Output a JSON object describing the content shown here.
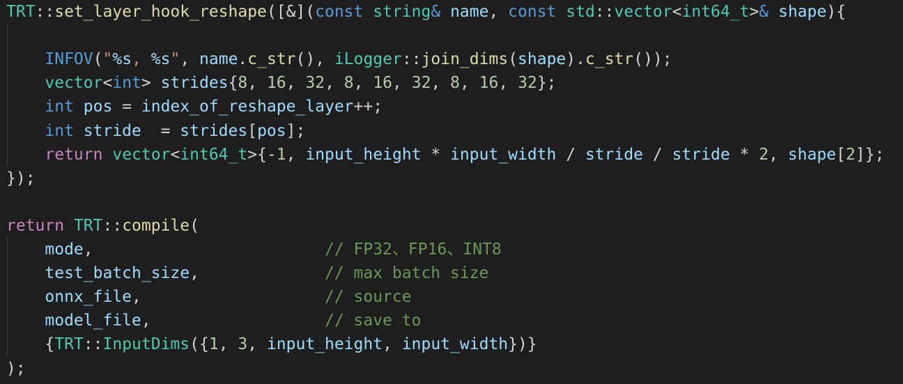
{
  "editor": {
    "theme_colors": {
      "background": "#1e1e1e",
      "plain": "#d4d4d4",
      "type": "#4ec9b0",
      "keyword": "#569cd6",
      "control": "#c586c0",
      "function": "#dcdcaa",
      "variable": "#9cdcfe",
      "string": "#ce9178",
      "number": "#b5cea8",
      "comment": "#6a9955"
    },
    "lines": [
      [
        {
          "t": "TRT",
          "c": "type"
        },
        {
          "t": "::",
          "c": "plain"
        },
        {
          "t": "set_layer_hook_reshape",
          "c": "fn"
        },
        {
          "t": "([&](",
          "c": "plain"
        },
        {
          "t": "const",
          "c": "kw"
        },
        {
          "t": " ",
          "c": "plain"
        },
        {
          "t": "string",
          "c": "type"
        },
        {
          "t": "&",
          "c": "kw"
        },
        {
          "t": " ",
          "c": "plain"
        },
        {
          "t": "name",
          "c": "var"
        },
        {
          "t": ", ",
          "c": "plain"
        },
        {
          "t": "const",
          "c": "kw"
        },
        {
          "t": " ",
          "c": "plain"
        },
        {
          "t": "std",
          "c": "type"
        },
        {
          "t": "::",
          "c": "plain"
        },
        {
          "t": "vector",
          "c": "type"
        },
        {
          "t": "<",
          "c": "plain"
        },
        {
          "t": "int64_t",
          "c": "type"
        },
        {
          "t": ">",
          "c": "plain"
        },
        {
          "t": "&",
          "c": "kw"
        },
        {
          "t": " ",
          "c": "plain"
        },
        {
          "t": "shape",
          "c": "var"
        },
        {
          "t": "){",
          "c": "plain"
        }
      ],
      [],
      [
        {
          "t": "    ",
          "c": "plain"
        },
        {
          "t": "INFOV",
          "c": "macro"
        },
        {
          "t": "(",
          "c": "plain"
        },
        {
          "t": "\"",
          "c": "str"
        },
        {
          "t": "%s",
          "c": "esc"
        },
        {
          "t": ", ",
          "c": "str"
        },
        {
          "t": "%s",
          "c": "esc"
        },
        {
          "t": "\"",
          "c": "str"
        },
        {
          "t": ", ",
          "c": "plain"
        },
        {
          "t": "name",
          "c": "var"
        },
        {
          "t": ".",
          "c": "plain"
        },
        {
          "t": "c_str",
          "c": "fn"
        },
        {
          "t": "(), ",
          "c": "plain"
        },
        {
          "t": "iLogger",
          "c": "type"
        },
        {
          "t": "::",
          "c": "plain"
        },
        {
          "t": "join_dims",
          "c": "fn"
        },
        {
          "t": "(",
          "c": "plain"
        },
        {
          "t": "shape",
          "c": "var"
        },
        {
          "t": ").",
          "c": "plain"
        },
        {
          "t": "c_str",
          "c": "fn"
        },
        {
          "t": "());",
          "c": "plain"
        }
      ],
      [
        {
          "t": "    ",
          "c": "plain"
        },
        {
          "t": "vector",
          "c": "type"
        },
        {
          "t": "<",
          "c": "plain"
        },
        {
          "t": "int",
          "c": "kw"
        },
        {
          "t": "> ",
          "c": "plain"
        },
        {
          "t": "strides",
          "c": "var"
        },
        {
          "t": "{",
          "c": "plain"
        },
        {
          "t": "8",
          "c": "num"
        },
        {
          "t": ", ",
          "c": "plain"
        },
        {
          "t": "16",
          "c": "num"
        },
        {
          "t": ", ",
          "c": "plain"
        },
        {
          "t": "32",
          "c": "num"
        },
        {
          "t": ", ",
          "c": "plain"
        },
        {
          "t": "8",
          "c": "num"
        },
        {
          "t": ", ",
          "c": "plain"
        },
        {
          "t": "16",
          "c": "num"
        },
        {
          "t": ", ",
          "c": "plain"
        },
        {
          "t": "32",
          "c": "num"
        },
        {
          "t": ", ",
          "c": "plain"
        },
        {
          "t": "8",
          "c": "num"
        },
        {
          "t": ", ",
          "c": "plain"
        },
        {
          "t": "16",
          "c": "num"
        },
        {
          "t": ", ",
          "c": "plain"
        },
        {
          "t": "32",
          "c": "num"
        },
        {
          "t": "};",
          "c": "plain"
        }
      ],
      [
        {
          "t": "    ",
          "c": "plain"
        },
        {
          "t": "int",
          "c": "kw"
        },
        {
          "t": " ",
          "c": "plain"
        },
        {
          "t": "pos",
          "c": "var"
        },
        {
          "t": " = ",
          "c": "plain"
        },
        {
          "t": "index_of_reshape_layer",
          "c": "var"
        },
        {
          "t": "++;",
          "c": "plain"
        }
      ],
      [
        {
          "t": "    ",
          "c": "plain"
        },
        {
          "t": "int",
          "c": "kw"
        },
        {
          "t": " ",
          "c": "plain"
        },
        {
          "t": "stride",
          "c": "var"
        },
        {
          "t": "  = ",
          "c": "plain"
        },
        {
          "t": "strides",
          "c": "var"
        },
        {
          "t": "[",
          "c": "plain"
        },
        {
          "t": "pos",
          "c": "var"
        },
        {
          "t": "];",
          "c": "plain"
        }
      ],
      [
        {
          "t": "    ",
          "c": "plain"
        },
        {
          "t": "return",
          "c": "ctrl"
        },
        {
          "t": " ",
          "c": "plain"
        },
        {
          "t": "vector",
          "c": "type"
        },
        {
          "t": "<",
          "c": "plain"
        },
        {
          "t": "int64_t",
          "c": "type"
        },
        {
          "t": ">{-",
          "c": "plain"
        },
        {
          "t": "1",
          "c": "num"
        },
        {
          "t": ", ",
          "c": "plain"
        },
        {
          "t": "input_height",
          "c": "var"
        },
        {
          "t": " * ",
          "c": "plain"
        },
        {
          "t": "input_width",
          "c": "var"
        },
        {
          "t": " / ",
          "c": "plain"
        },
        {
          "t": "stride",
          "c": "var"
        },
        {
          "t": " / ",
          "c": "plain"
        },
        {
          "t": "stride",
          "c": "var"
        },
        {
          "t": " * ",
          "c": "plain"
        },
        {
          "t": "2",
          "c": "num"
        },
        {
          "t": ", ",
          "c": "plain"
        },
        {
          "t": "shape",
          "c": "var"
        },
        {
          "t": "[",
          "c": "plain"
        },
        {
          "t": "2",
          "c": "num"
        },
        {
          "t": "]};",
          "c": "plain"
        }
      ],
      [
        {
          "t": "});",
          "c": "plain"
        }
      ],
      [],
      [
        {
          "t": "return",
          "c": "ctrl"
        },
        {
          "t": " ",
          "c": "plain"
        },
        {
          "t": "TRT",
          "c": "type"
        },
        {
          "t": "::",
          "c": "plain"
        },
        {
          "t": "compile",
          "c": "fn"
        },
        {
          "t": "(",
          "c": "plain"
        }
      ],
      [
        {
          "t": "    ",
          "c": "plain"
        },
        {
          "t": "mode",
          "c": "var"
        },
        {
          "t": ",                        ",
          "c": "plain"
        },
        {
          "t": "// FP32、FP16、INT8",
          "c": "comment"
        }
      ],
      [
        {
          "t": "    ",
          "c": "plain"
        },
        {
          "t": "test_batch_size",
          "c": "var"
        },
        {
          "t": ",             ",
          "c": "plain"
        },
        {
          "t": "// max batch size",
          "c": "comment"
        }
      ],
      [
        {
          "t": "    ",
          "c": "plain"
        },
        {
          "t": "onnx_file",
          "c": "var"
        },
        {
          "t": ",                   ",
          "c": "plain"
        },
        {
          "t": "// source",
          "c": "comment"
        }
      ],
      [
        {
          "t": "    ",
          "c": "plain"
        },
        {
          "t": "model_file",
          "c": "var"
        },
        {
          "t": ",                  ",
          "c": "plain"
        },
        {
          "t": "// save to",
          "c": "comment"
        }
      ],
      [
        {
          "t": "    ",
          "c": "plain"
        },
        {
          "t": "{",
          "c": "plain"
        },
        {
          "t": "TRT",
          "c": "type"
        },
        {
          "t": "::",
          "c": "plain"
        },
        {
          "t": "InputDims",
          "c": "type"
        },
        {
          "t": "({",
          "c": "plain"
        },
        {
          "t": "1",
          "c": "num"
        },
        {
          "t": ", ",
          "c": "plain"
        },
        {
          "t": "3",
          "c": "num"
        },
        {
          "t": ", ",
          "c": "plain"
        },
        {
          "t": "input_height",
          "c": "var"
        },
        {
          "t": ", ",
          "c": "plain"
        },
        {
          "t": "input_width",
          "c": "var"
        },
        {
          "t": "})}",
          "c": "plain"
        }
      ],
      [
        {
          "t": ");",
          "c": "plain"
        }
      ]
    ]
  }
}
